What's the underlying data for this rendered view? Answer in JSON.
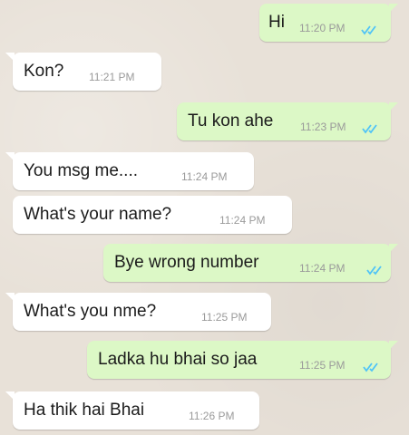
{
  "chat": {
    "messages": [
      {
        "direction": "outgoing",
        "text": "Hi",
        "time": "11:20 PM",
        "status": "read-double-check-icon"
      },
      {
        "direction": "incoming",
        "text": "Kon?",
        "time": "11:21 PM"
      },
      {
        "direction": "outgoing",
        "text": "Tu kon ahe",
        "time": "11:23 PM",
        "status": "read-double-check-icon"
      },
      {
        "direction": "incoming",
        "text": "You msg me....",
        "time": "11:24 PM"
      },
      {
        "direction": "incoming",
        "text": "What's your name?",
        "time": "11:24 PM"
      },
      {
        "direction": "outgoing",
        "text": "Bye wrong number",
        "time": "11:24 PM",
        "status": "read-double-check-icon"
      },
      {
        "direction": "incoming",
        "text": "What's you nme?",
        "time": "11:25 PM"
      },
      {
        "direction": "outgoing",
        "text": "Ladka hu bhai so jaa",
        "time": "11:25 PM",
        "status": "read-double-check-icon"
      },
      {
        "direction": "incoming",
        "text": "Ha thik hai Bhai",
        "time": "11:26 PM"
      }
    ]
  },
  "colors": {
    "background": "#e8e1d8",
    "incoming_bubble": "#ffffff",
    "outgoing_bubble": "#dcf8c6",
    "read_ticks": "#4fc3f7",
    "timestamp": "#9a9a9a"
  }
}
